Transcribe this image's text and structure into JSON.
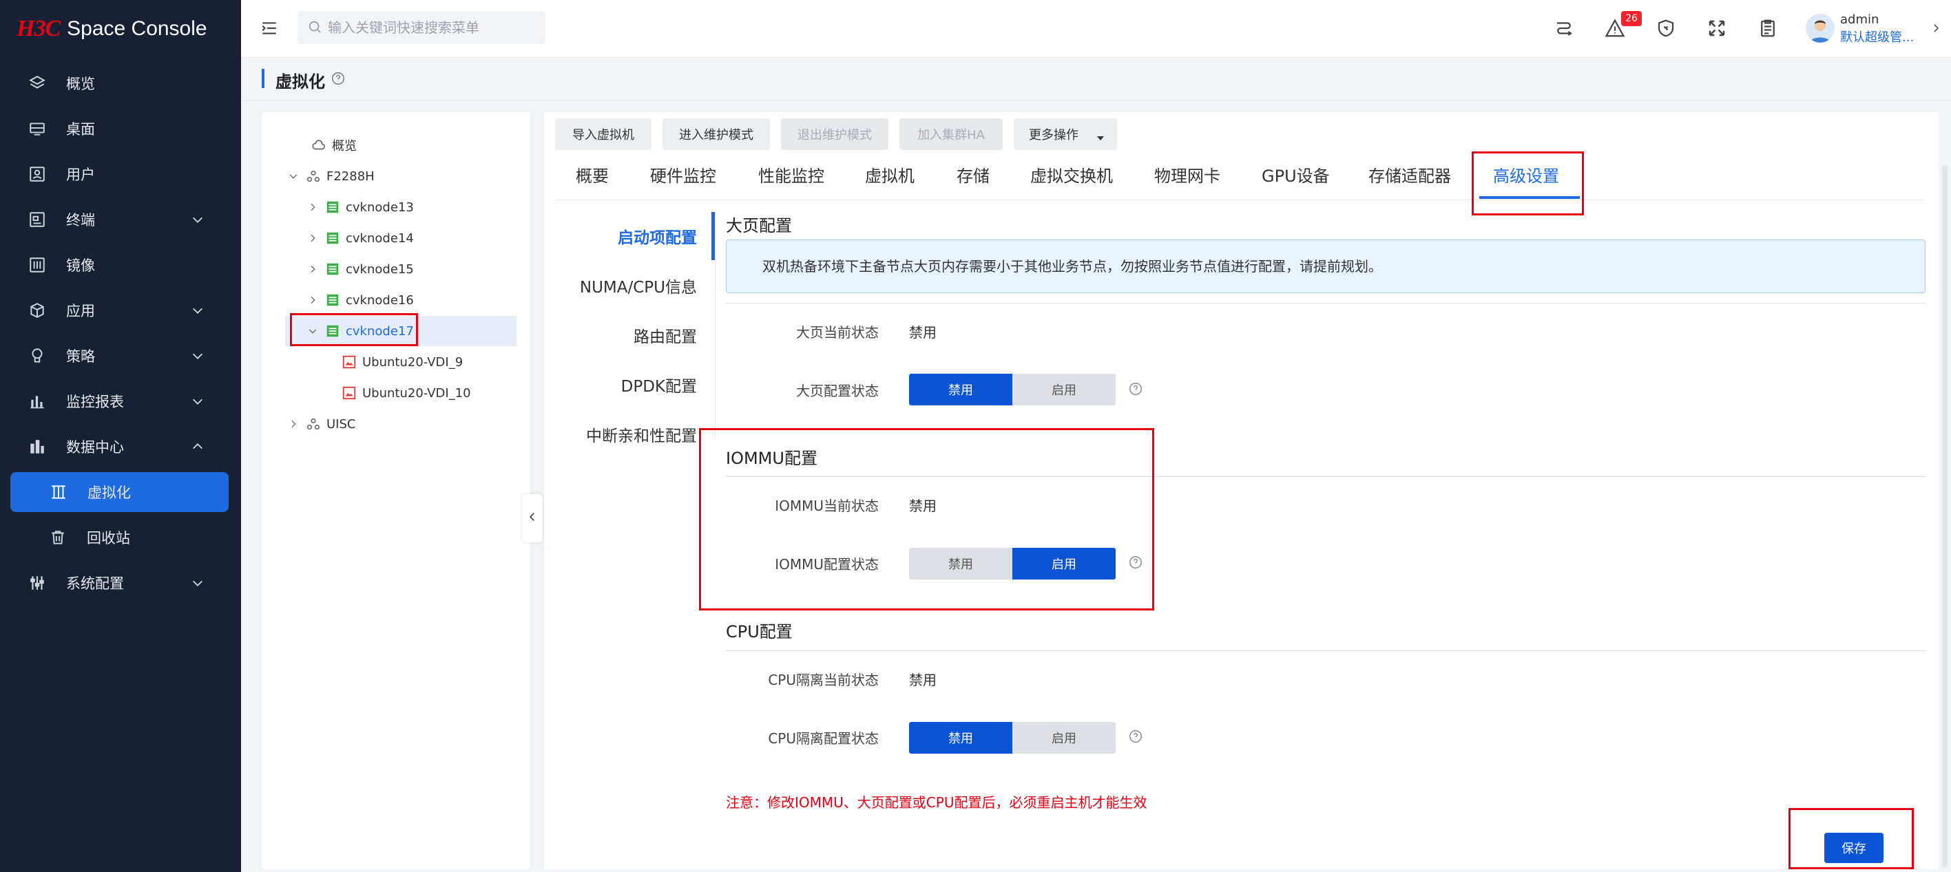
{
  "app": {
    "brand": "H3C",
    "product": "Space Console"
  },
  "sidebar": {
    "items": [
      {
        "label": "概览",
        "icon": "layers-icon"
      },
      {
        "label": "桌面",
        "icon": "desktop-icon"
      },
      {
        "label": "用户",
        "icon": "user-icon"
      },
      {
        "label": "终端",
        "icon": "terminal-icon"
      },
      {
        "label": "镜像",
        "icon": "image-icon"
      },
      {
        "label": "应用",
        "icon": "app-icon"
      },
      {
        "label": "策略",
        "icon": "policy-icon"
      },
      {
        "label": "监控报表",
        "icon": "chart-icon"
      },
      {
        "label": "数据中心",
        "icon": "datacenter-icon"
      },
      {
        "label": "虚拟化",
        "icon": "virtualization-icon"
      },
      {
        "label": "回收站",
        "icon": "trash-icon"
      },
      {
        "label": "系统配置",
        "icon": "settings-icon"
      }
    ]
  },
  "header": {
    "search_placeholder": "输入关键词快速搜索菜单",
    "alarm_count": "26",
    "user_name": "admin",
    "user_role": "默认超级管..."
  },
  "page": {
    "title": "虚拟化"
  },
  "tree": {
    "items": [
      {
        "label": "概览"
      },
      {
        "label": "F2288H"
      },
      {
        "label": "cvknode13"
      },
      {
        "label": "cvknode14"
      },
      {
        "label": "cvknode15"
      },
      {
        "label": "cvknode16"
      },
      {
        "label": "cvknode17"
      },
      {
        "label": "Ubuntu20-VDI_9"
      },
      {
        "label": "Ubuntu20-VDI_10"
      },
      {
        "label": "UISC"
      }
    ]
  },
  "actions": {
    "import_vm": "导入虚拟机",
    "enter_maintenance": "进入维护模式",
    "exit_maintenance": "退出维护模式",
    "join_ha": "加入集群HA",
    "more": "更多操作"
  },
  "tabs": [
    "概要",
    "硬件监控",
    "性能监控",
    "虚拟机",
    "存储",
    "虚拟交换机",
    "物理网卡",
    "GPU设备",
    "存储适配器",
    "高级设置"
  ],
  "left_nav": [
    "启动项配置",
    "NUMA/CPU信息",
    "路由配置",
    "DPDK配置",
    "中断亲和性配置"
  ],
  "hugepage": {
    "title": "大页配置",
    "info": "双机热备环境下主备节点大页内存需要小于其他业务节点，勿按照业务节点值进行配置，请提前规划。",
    "current_label": "大页当前状态",
    "current_value": "禁用",
    "config_label": "大页配置状态",
    "disable": "禁用",
    "enable": "启用"
  },
  "iommu": {
    "title": "IOMMU配置",
    "current_label": "IOMMU当前状态",
    "current_value": "禁用",
    "config_label": "IOMMU配置状态",
    "disable": "禁用",
    "enable": "启用"
  },
  "cpu": {
    "title": "CPU配置",
    "current_label": "CPU隔离当前状态",
    "current_value": "禁用",
    "config_label": "CPU隔离配置状态",
    "disable": "禁用",
    "enable": "启用"
  },
  "note": "注意：修改IOMMU、大页配置或CPU配置后，必须重启主机才能生效",
  "save_label": "保存",
  "colors": {
    "primary": "#1e6ae0",
    "sidebar_bg": "#172133",
    "highlight": "#e60012",
    "button_on": "#0b54d6"
  }
}
